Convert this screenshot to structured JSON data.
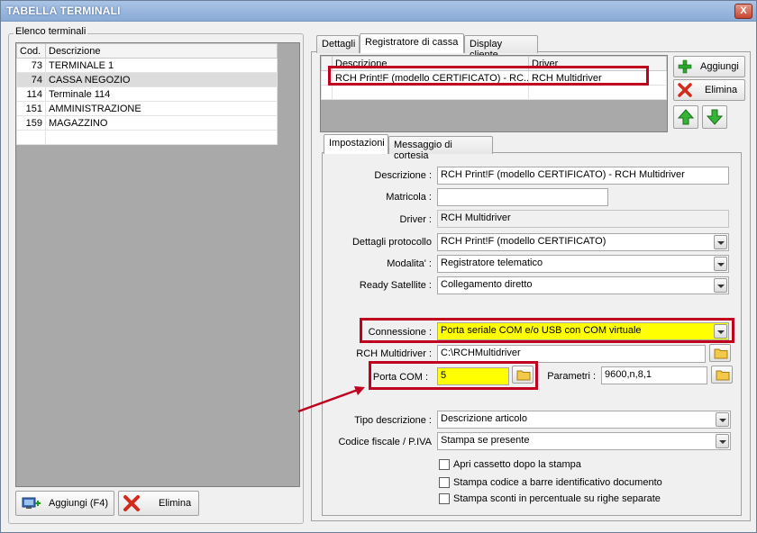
{
  "window": {
    "title": "TABELLA TERMINALI",
    "close_glyph": "X"
  },
  "left": {
    "group_title": "Elenco terminali",
    "columns": [
      "Cod.",
      "Descrizione"
    ],
    "rows": [
      {
        "cod": "73",
        "desc": "TERMINALE 1",
        "selected": false
      },
      {
        "cod": "74",
        "desc": "CASSA NEGOZIO",
        "selected": true
      },
      {
        "cod": "114",
        "desc": "Terminale 114",
        "selected": false
      },
      {
        "cod": "151",
        "desc": "AMMINISTRAZIONE",
        "selected": false
      },
      {
        "cod": "159",
        "desc": "MAGAZZINO",
        "selected": false
      },
      {
        "cod": "",
        "desc": "",
        "selected": false
      }
    ],
    "add_button": "Aggiungi (F4)",
    "delete_button": "Elimina"
  },
  "tabs": [
    "Dettagli",
    "Registratore di cassa",
    "Display cliente"
  ],
  "active_tab": "Registratore di cassa",
  "registers": {
    "columns": [
      "Descrizione",
      "Driver"
    ],
    "rows": [
      {
        "descrizione": "RCH Print!F (modello CERTIFICATO) - RC...",
        "driver": "RCH Multidriver"
      }
    ],
    "add_button": "Aggiungi",
    "delete_button": "Elimina"
  },
  "subtabs": [
    "Impostazioni",
    "Messaggio di cortesia"
  ],
  "form": {
    "descrizione_label": "Descrizione :",
    "descrizione_value": "RCH Print!F (modello CERTIFICATO) - RCH Multidriver",
    "matricola_label": "Matricola :",
    "matricola_value": "",
    "driver_label": "Driver :",
    "driver_value": "RCH Multidriver",
    "protocollo_label": "Dettagli protocollo",
    "protocollo_value": "RCH Print!F (modello CERTIFICATO)",
    "modalita_label": "Modalita' :",
    "modalita_value": "Registratore telematico",
    "ready_label": "Ready Satellite :",
    "ready_value": "Collegamento diretto",
    "connessione_label": "Connessione :",
    "connessione_value": "Porta seriale COM e/o USB con COM virtuale",
    "multidriver_label": "RCH Multidriver :",
    "multidriver_value": "C:\\RCHMultidriver",
    "porta_label": "Porta COM :",
    "porta_value": "5",
    "parametri_label": "Parametri :",
    "parametri_value": "9600,n,8,1",
    "tipo_label": "Tipo descrizione :",
    "tipo_value": "Descrizione articolo",
    "codice_label": "Codice fiscale / P.IVA",
    "codice_value": "Stampa se presente",
    "checkboxes": [
      "Apri cassetto dopo la stampa",
      "Stampa codice a barre identificativo documento",
      "Stampa sconti in percentuale su righe separate"
    ]
  },
  "colors": {
    "highlight_red": "#c0001f",
    "field_yellow": "#ffff00",
    "title_blue": "#8aabd6"
  },
  "icons": [
    "close-icon",
    "add-icon",
    "delete-icon",
    "arrow-up-icon",
    "arrow-down-icon",
    "folder-icon",
    "dropdown-arrow-icon"
  ]
}
